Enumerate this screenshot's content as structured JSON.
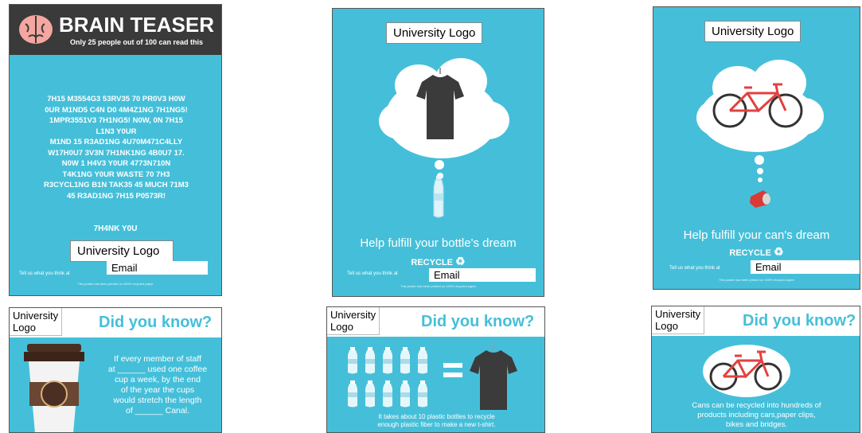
{
  "poster1": {
    "title": "BRAIN TEASER",
    "subtitle": "Only 25 people out of 100 can read this",
    "body_lines": [
      "7H15 M3554G3 53RV35 70 PR0V3 H0W",
      "0UR M1ND5 C4N D0 4M4Z1NG 7H1NG5!",
      "1MPR3551V3 7H1NG5! N0W, 0N 7H15",
      "L1N3 Y0UR",
      "M1ND 15 R3AD1NG 4U70M471C4LLY",
      "W17H0U7 3V3N 7H1NK1NG 4B0U7 17.",
      "N0W 1 H4V3 Y0UR 4773N710N",
      "T4K1NG Y0UR WASTE 70 7H3",
      "R3CYCL1NG B1N TAK35 45 MUCH 71M3",
      "45 R3AD1NG 7H15 P0573R!"
    ],
    "thanks": "7H4NK Y0U",
    "logo": "University Logo",
    "tell": "Tell us what you think at",
    "email": "Email",
    "printed": "This poster has been printed on 100% recycled paper"
  },
  "poster2": {
    "logo": "University Logo",
    "headline": "Help fulfill your bottle's dream",
    "recycle": "RECYCLE",
    "tell": "Tell us what you think at",
    "email": "Email",
    "printed": "This poster has been printed on 100% recycled paper"
  },
  "poster3": {
    "logo": "University Logo",
    "headline": "Help fulfill your can's dream",
    "recycle": "RECYCLE",
    "tell": "Tell us what you think at",
    "email": "Email",
    "printed": "This poster has been printed on 100% recycled paper"
  },
  "poster4": {
    "logo_line1": "University",
    "logo_line2": "Logo",
    "title": "Did you know?",
    "text_lines": [
      "If every member of staff",
      "at ______ used one coffee",
      "cup a week, by the end",
      "of the year the cups",
      "would stretch the length",
      "of ______ Canal."
    ]
  },
  "poster5": {
    "logo_line1": "University",
    "logo_line2": "Logo",
    "title": "Did you know?",
    "text_lines": [
      "It takes about 10 plastic bottles to recycle",
      "enough plastic fiber to make a new t-shirt."
    ]
  },
  "poster6": {
    "logo_line1": "University",
    "logo_line2": "Logo",
    "title": "Did you know?",
    "text_lines": [
      "Cans can be recycled into hundreds of",
      "products including cars,paper clips,",
      "bikes and bridges."
    ]
  },
  "colors": {
    "poster_blue": "#45bfd9",
    "header_dark": "#3a3a3a",
    "bike_red": "#e2413f",
    "brain_pink": "#f4a7a0"
  }
}
